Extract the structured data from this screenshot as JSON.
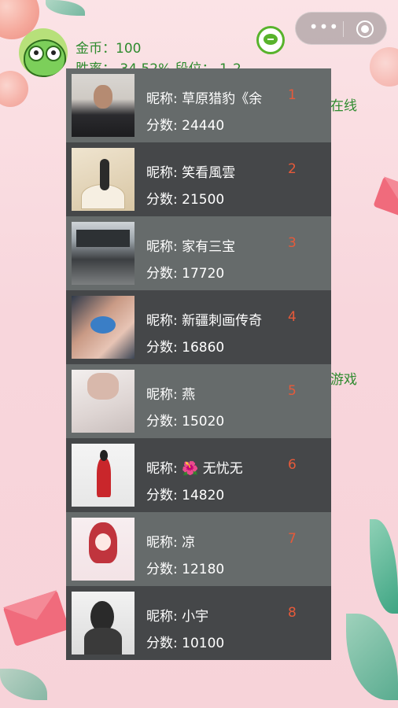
{
  "header": {
    "coins_label": "金币",
    "coins_value": "100",
    "winrate_label": "胜率",
    "winrate_value": "34.52%",
    "rank_label": "段位",
    "rank_value": "1-2",
    "capsule_more": "•••"
  },
  "background_labels": {
    "online": "在线",
    "games": "游戏"
  },
  "field_labels": {
    "nickname": "昵称: ",
    "score": "分数: "
  },
  "leaderboard": [
    {
      "rank": "1",
      "nickname": "草原猎豹《余",
      "score": "24440"
    },
    {
      "rank": "2",
      "nickname": "笑看風雲",
      "score": "21500"
    },
    {
      "rank": "3",
      "nickname": "家有三宝",
      "score": "17720"
    },
    {
      "rank": "4",
      "nickname": "新疆刺画传奇",
      "score": "16860"
    },
    {
      "rank": "5",
      "nickname": "燕",
      "score": "15020"
    },
    {
      "rank": "6",
      "nickname": "🌺 无忧无",
      "score": "14820"
    },
    {
      "rank": "7",
      "nickname": "凉",
      "score": "12180"
    },
    {
      "rank": "8",
      "nickname": "小宇",
      "score": "10100"
    }
  ],
  "icons": {
    "avatar": "frog-avatar-icon",
    "chat": "chat-bubble-icon",
    "more": "more-dots-icon",
    "close": "close-miniprogram-icon"
  }
}
